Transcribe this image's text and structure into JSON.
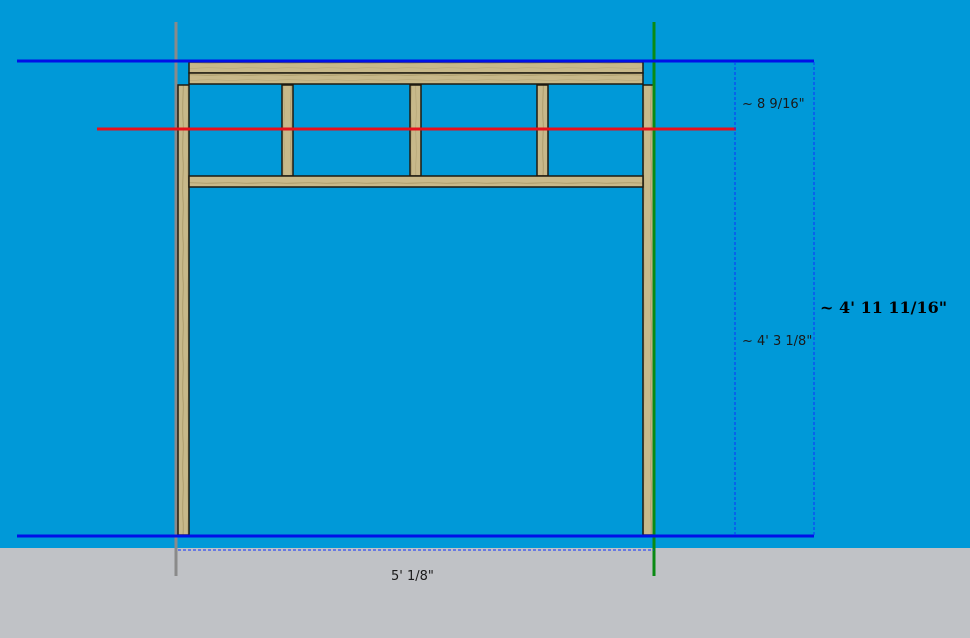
{
  "colors": {
    "sky": "#0099d8",
    "ground": "#c0c2c6",
    "wood": "#c8b98a",
    "wood_edge": "#1e1a10",
    "guide_blue": "#0010e8",
    "guide_red": "#e8101a",
    "axis_green": "#0a8a14",
    "axis_gray": "#8a8a8a",
    "dim_dash": "#1030ff"
  },
  "dimensions": {
    "header_height": "~ 8 9/16\"",
    "opening_height": "~ 4' 3 1/8\"",
    "total_height": "~ 4' 11 11/16\"",
    "total_width": "5' 1/8\""
  }
}
